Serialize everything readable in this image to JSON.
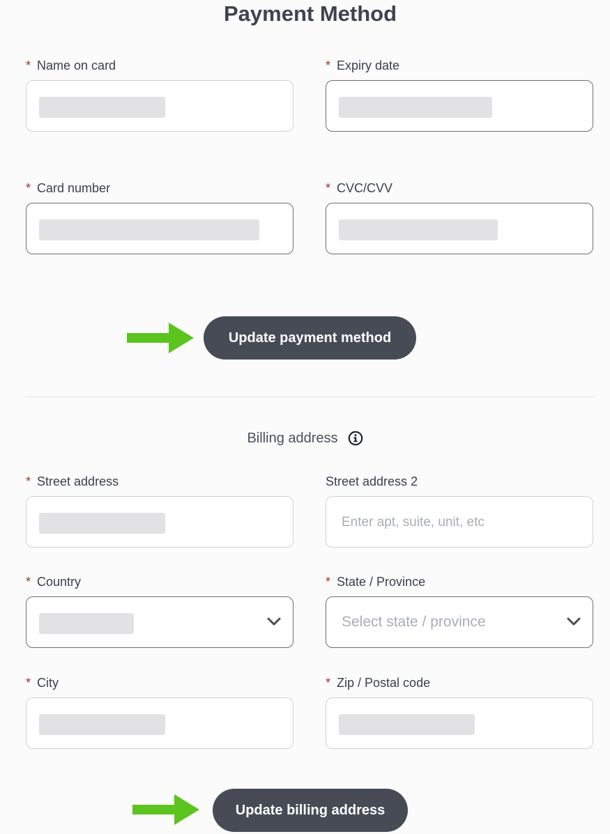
{
  "title": "Payment Method",
  "payment": {
    "name_on_card": {
      "label": "Name on card",
      "required": "*"
    },
    "expiry_date": {
      "label": "Expiry date",
      "required": "*"
    },
    "card_number": {
      "label": "Card number",
      "required": "*"
    },
    "cvc": {
      "label": "CVC/CVV",
      "required": "*"
    },
    "update_button": "Update payment method"
  },
  "billing": {
    "section_title": "Billing address",
    "street_address": {
      "label": "Street address",
      "required": "*"
    },
    "street_address_2": {
      "label": "Street address 2",
      "placeholder": "Enter apt, suite, unit, etc"
    },
    "country": {
      "label": "Country",
      "required": "*"
    },
    "state": {
      "label": "State / Province",
      "required": "*",
      "placeholder": "Select state / province"
    },
    "city": {
      "label": "City",
      "required": "*"
    },
    "zip": {
      "label": "Zip / Postal code",
      "required": "*"
    },
    "update_button": "Update billing address"
  },
  "icons": {
    "info": "info-icon",
    "chevron": "chevron-down-icon",
    "arrow": "arrow-right-icon"
  },
  "colors": {
    "button_bg": "#464b56",
    "required_star": "#a03030",
    "arrow": "#5cc41f"
  }
}
